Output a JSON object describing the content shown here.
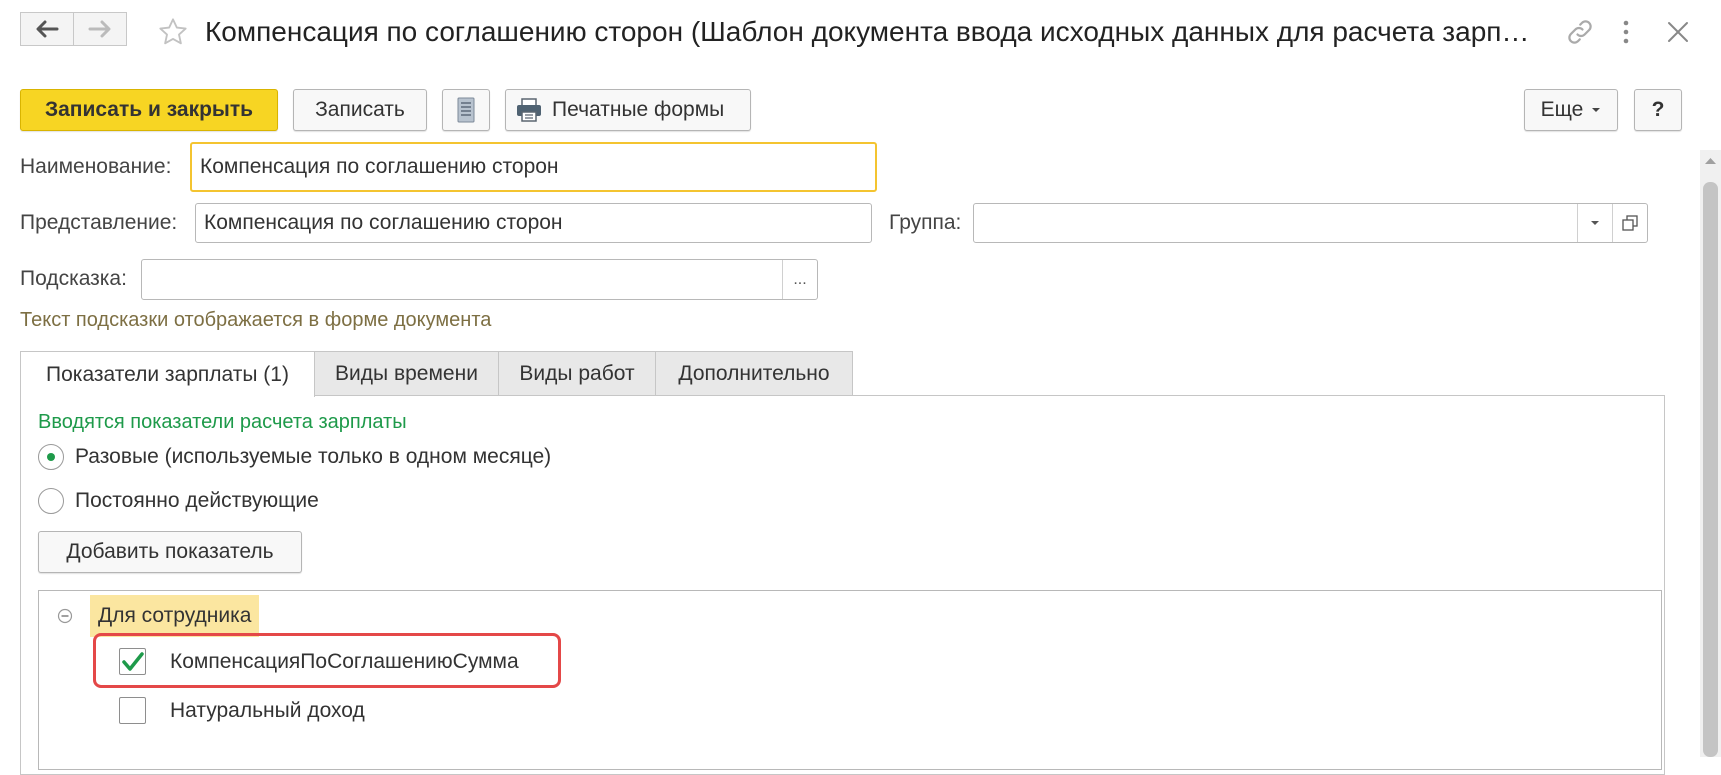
{
  "window": {
    "title": "Компенсация по соглашению сторон (Шаблон документа ввода исходных данных для расчета зарплаты)"
  },
  "toolbar": {
    "save_close_label": "Записать и закрыть",
    "save_label": "Записать",
    "print_forms_label": "Печатные формы",
    "more_label": "Еще",
    "help_label": "?"
  },
  "form": {
    "name_label": "Наименование:",
    "name_value": "Компенсация по соглашению сторон",
    "presentation_label": "Представление:",
    "presentation_value": "Компенсация по соглашению сторон",
    "group_label": "Группа:",
    "group_value": "",
    "hint_label": "Подсказка:",
    "hint_value": "",
    "hint_button_label": "...",
    "hint_note": "Текст подсказки отображается в форме документа"
  },
  "tabs": [
    {
      "label": "Показатели зарплаты (1)"
    },
    {
      "label": "Виды времени"
    },
    {
      "label": "Виды работ"
    },
    {
      "label": "Дополнительно"
    }
  ],
  "panel": {
    "section_title": "Вводятся показатели расчета зарплаты",
    "radio_options": [
      {
        "label": "Разовые (используемые только в одном месяце)",
        "selected": true
      },
      {
        "label": "Постоянно действующие",
        "selected": false
      }
    ],
    "add_indicator_label": "Добавить показатель",
    "tree": {
      "group_label": "Для сотрудника",
      "items": [
        {
          "label": "КомпенсацияПоСоглашениюСумма",
          "checked": true
        },
        {
          "label": "Натуральный доход",
          "checked": false
        }
      ]
    }
  },
  "colors": {
    "primary_button": "#f7d523",
    "focus_border": "#f4c430",
    "hint_text": "#7d6f43",
    "section_text": "#1e9a4a",
    "check_green": "#1e9a4a",
    "highlight_bg": "#fbe6a0",
    "annotation_red": "#e44848"
  }
}
